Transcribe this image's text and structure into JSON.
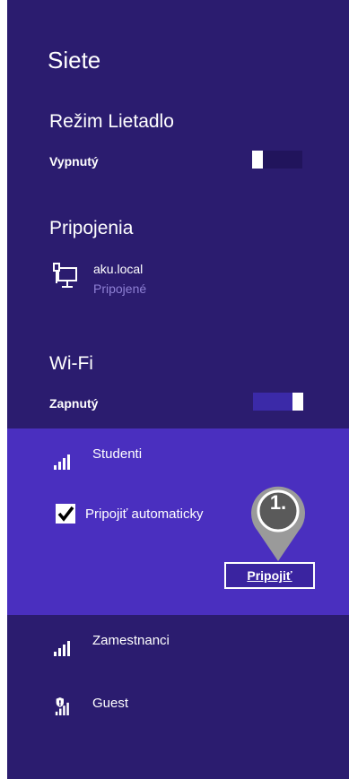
{
  "panel": {
    "title": "Siete"
  },
  "airplane": {
    "title": "Režim Lietadlo",
    "status": "Vypnutý"
  },
  "connections": {
    "title": "Pripojenia",
    "item": {
      "name": "aku.local",
      "status": "Pripojené"
    }
  },
  "wifi": {
    "title": "Wi-Fi",
    "status": "Zapnutý",
    "networks": [
      {
        "name": "Studenti",
        "icon": "wifi-signal-icon"
      },
      {
        "name": "Zamestnanci",
        "icon": "wifi-signal-icon"
      },
      {
        "name": "Guest",
        "icon": "wifi-shield-signal-icon"
      }
    ],
    "selected": {
      "auto_label": "Pripojiť automaticky",
      "auto_checked": true,
      "connect_label": "Pripojiť"
    }
  },
  "callout": {
    "label": "1."
  },
  "colors": {
    "background": "#2b1c6f",
    "selected": "#4a2fbf",
    "accent": "#3b2aa8",
    "muted_text": "#8e80d4"
  }
}
